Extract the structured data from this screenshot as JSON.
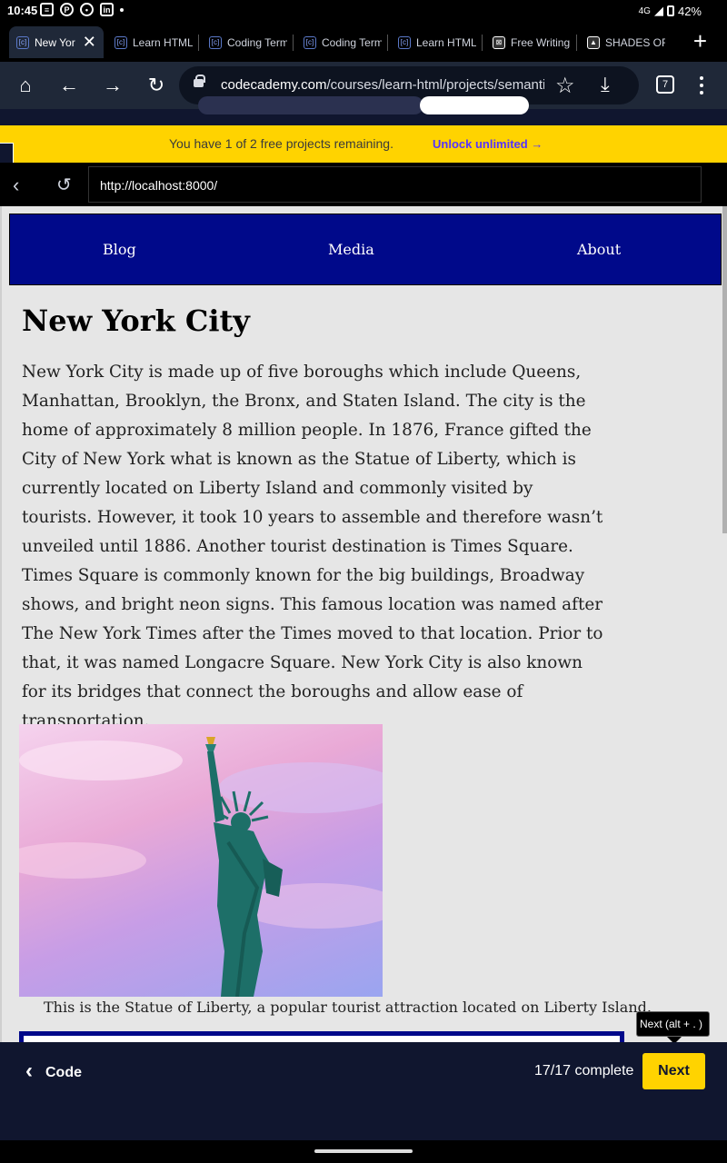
{
  "status": {
    "time": "10:45",
    "network": "4G",
    "battery": "42%"
  },
  "tabs": [
    {
      "title": "New Yor",
      "active": true
    },
    {
      "title": "Learn HTML"
    },
    {
      "title": "Coding Term"
    },
    {
      "title": "Coding Term"
    },
    {
      "title": "Learn HTML:"
    },
    {
      "title": "Free Writing"
    },
    {
      "title": "SHADES OF I"
    }
  ],
  "toolbar": {
    "url_host": "codecademy.com",
    "url_path": "/courses/learn-html/projects/semantic-",
    "tab_count": "7"
  },
  "promo": {
    "message": "You have 1 of 2 free projects remaining.",
    "cta": "Unlock unlimited"
  },
  "preview": {
    "address": "http://localhost:8000/"
  },
  "site_nav": [
    "Blog",
    "Media",
    "About"
  ],
  "article": {
    "title": "New York City",
    "body": "New York City is made up of five boroughs which include Queens, Manhattan, Brooklyn, the Bronx, and Staten Island. The city is the home of approximately 8 million people. In 1876, France gifted the City of New York what is known as the Statue of Liberty, which is currently located on Liberty Island and commonly visited by tourists. However, it took 10 years to assemble and therefore wasn’t unveiled until 1886. Another tourist destination is Times Square. Times Square is commonly known for the big buildings, Broadway shows, and bright neon signs. This famous location was named after The New York Times after the Times moved to that location. Prior to that, it was named Longacre Square. New York City is also known for its bridges that connect the boroughs and allow ease of transportation.",
    "caption": "This is the Statue of Liberty, a popular tourist attraction located on Liberty Island."
  },
  "tooltip": "Next (alt + . )",
  "bottom": {
    "code_label": "Code",
    "progress": "17/17 complete",
    "next_label": "Next"
  }
}
